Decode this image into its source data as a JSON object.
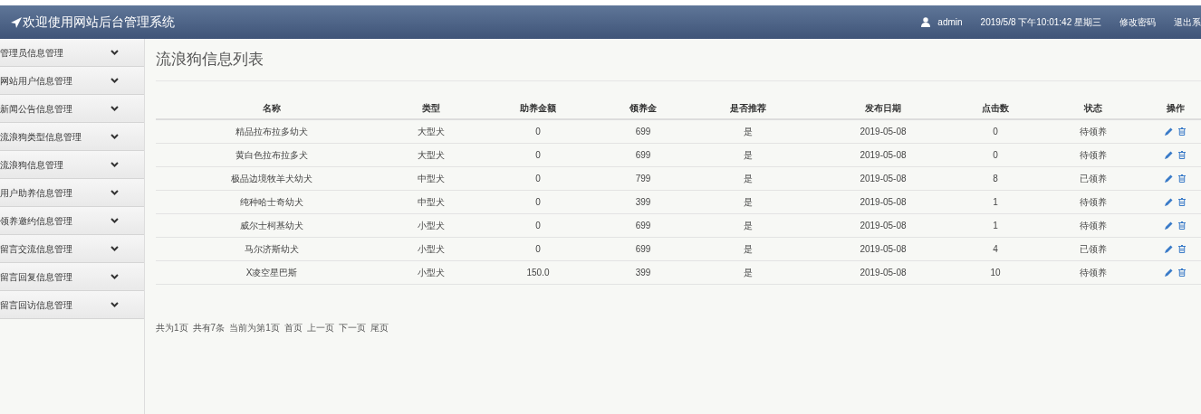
{
  "header": {
    "title": "欢迎使用网站后台管理系统",
    "user": "admin",
    "datetime": "2019/5/8 下午10:01:42 星期三",
    "links": [
      "修改密码",
      "退出系"
    ]
  },
  "sidebar": {
    "items": [
      {
        "label": "管理员信息管理",
        "expanded": false
      },
      {
        "label": "网站用户信息管理",
        "expanded": false
      },
      {
        "label": "新闻公告信息管理",
        "expanded": false
      },
      {
        "label": "流浪狗类型信息管理",
        "expanded": false
      },
      {
        "label": "流浪狗信息管理",
        "expanded": false
      },
      {
        "label": "用户助养信息管理",
        "expanded": false
      },
      {
        "label": "领养邀约信息管理",
        "expanded": false
      },
      {
        "label": "留言交流信息管理",
        "expanded": false
      },
      {
        "label": "留言回复信息管理",
        "expanded": false
      },
      {
        "label": "留言回访信息管理",
        "expanded": false
      }
    ]
  },
  "page_title": "流浪狗信息列表",
  "table": {
    "columns": [
      "名称",
      "类型",
      "助养金额",
      "领养金",
      "是否推荐",
      "发布日期",
      "点击数",
      "状态",
      "操作"
    ],
    "rows": [
      [
        "精品拉布拉多幼犬",
        "大型犬",
        "0",
        "699",
        "是",
        "2019-05-08",
        "0",
        "待领养"
      ],
      [
        "黄白色拉布拉多犬",
        "大型犬",
        "0",
        "699",
        "是",
        "2019-05-08",
        "0",
        "待领养"
      ],
      [
        "极品边境牧羊犬幼犬",
        "中型犬",
        "0",
        "799",
        "是",
        "2019-05-08",
        "8",
        "已领养"
      ],
      [
        "纯种哈士奇幼犬",
        "中型犬",
        "0",
        "399",
        "是",
        "2019-05-08",
        "1",
        "待领养"
      ],
      [
        "威尔士柯基幼犬",
        "小型犬",
        "0",
        "699",
        "是",
        "2019-05-08",
        "1",
        "待领养"
      ],
      [
        "马尔济斯幼犬",
        "小型犬",
        "0",
        "699",
        "是",
        "2019-05-08",
        "4",
        "已领养"
      ],
      [
        "X凌空星巴斯",
        "小型犬",
        "150.0",
        "399",
        "是",
        "2019-05-08",
        "10",
        "待领养"
      ]
    ]
  },
  "pagination": {
    "summary": [
      "共为1页",
      "共有7条",
      "当前为第1页"
    ],
    "links": [
      "首页",
      "上一页",
      "下一页",
      "尾页"
    ]
  }
}
